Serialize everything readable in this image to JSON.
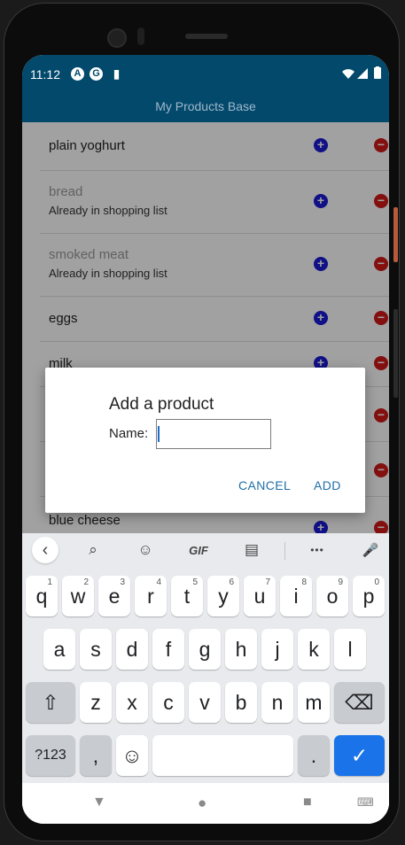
{
  "status": {
    "time": "11:12",
    "icons": [
      "A",
      "G",
      "▮"
    ]
  },
  "app": {
    "title": "My Products Base"
  },
  "products": [
    {
      "name": "plain yoghurt",
      "sub": "",
      "dim": false
    },
    {
      "name": "bread",
      "sub": "Already in shopping list",
      "dim": true
    },
    {
      "name": "smoked meat",
      "sub": "Already in shopping list",
      "dim": true
    },
    {
      "name": "eggs",
      "sub": "",
      "dim": false
    },
    {
      "name": "milk",
      "sub": "",
      "dim": false
    },
    {
      "name": "blue cheese",
      "sub": "",
      "dim": false
    }
  ],
  "dialog": {
    "title": "Add a product",
    "label": "Name:",
    "input_value": "",
    "cancel": "CANCEL",
    "add": "ADD"
  },
  "keyboard": {
    "suggestion": {
      "back": "‹",
      "search": "⌕",
      "sticker": "☺",
      "gif": "GIF",
      "clipboard": "▤",
      "more": "•••",
      "mic": "🎤"
    },
    "row1": [
      {
        "k": "q",
        "h": "1"
      },
      {
        "k": "w",
        "h": "2"
      },
      {
        "k": "e",
        "h": "3"
      },
      {
        "k": "r",
        "h": "4"
      },
      {
        "k": "t",
        "h": "5"
      },
      {
        "k": "y",
        "h": "6"
      },
      {
        "k": "u",
        "h": "7"
      },
      {
        "k": "i",
        "h": "8"
      },
      {
        "k": "o",
        "h": "9"
      },
      {
        "k": "p",
        "h": "0"
      }
    ],
    "row2": [
      "a",
      "s",
      "d",
      "f",
      "g",
      "h",
      "j",
      "k",
      "l"
    ],
    "row3": [
      "z",
      "x",
      "c",
      "v",
      "b",
      "n",
      "m"
    ],
    "shift": "⇧",
    "backspace": "⌫",
    "numbers": "?123",
    "comma": ",",
    "emoji": "☺",
    "period": ".",
    "enter": "✓"
  },
  "nav": {
    "back": "▼",
    "home": "●",
    "recents": "■",
    "kb": "⌨"
  }
}
